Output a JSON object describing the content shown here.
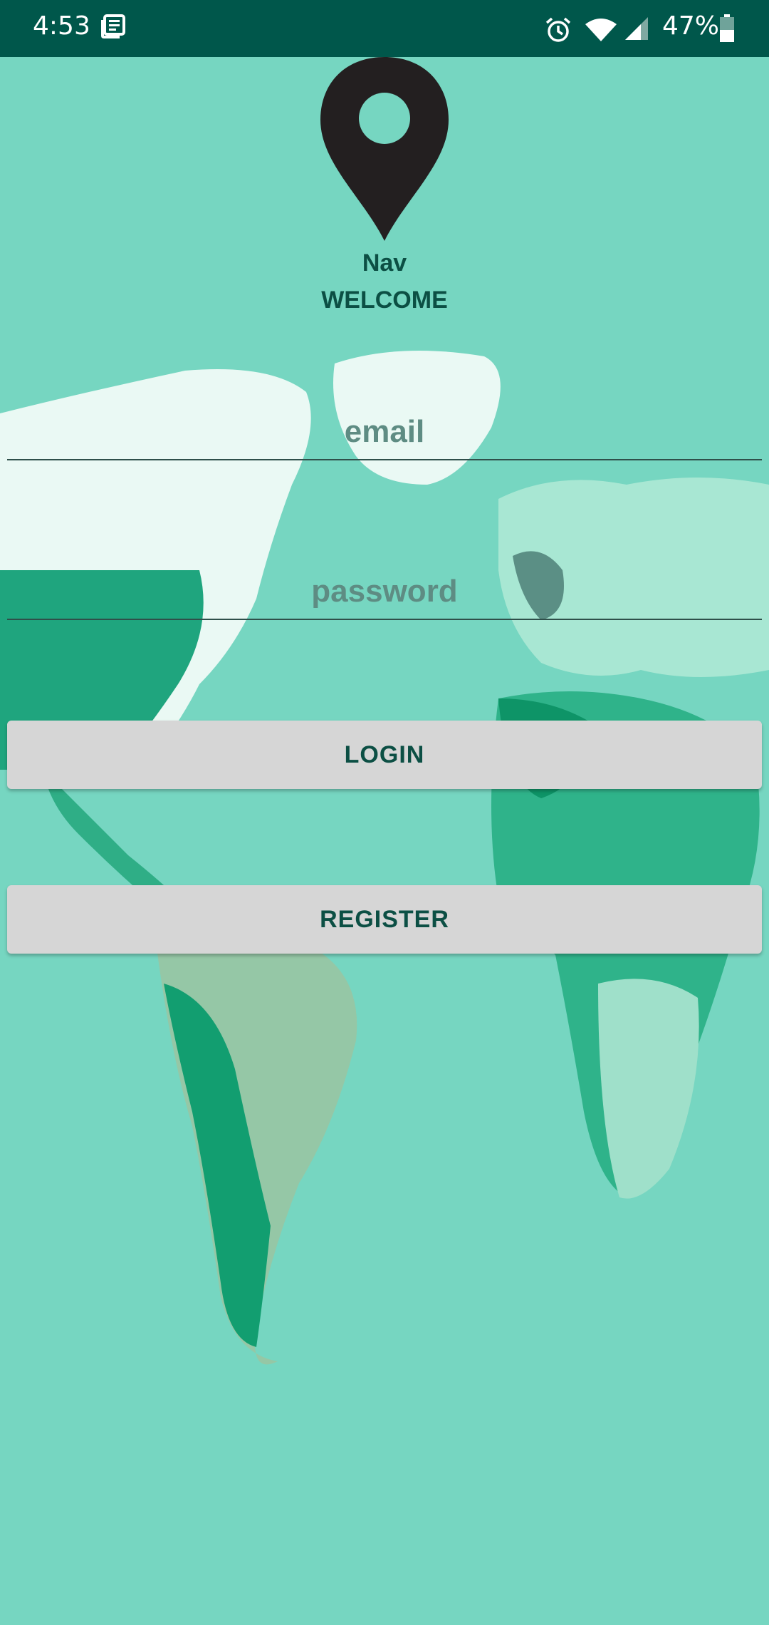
{
  "status_bar": {
    "time": "4:53",
    "battery": "47%",
    "icons": [
      "news-icon",
      "alarm-icon",
      "wifi-icon",
      "cell-signal-icon",
      "battery-icon"
    ]
  },
  "app": {
    "name": "Nav",
    "welcome": "WELCOME",
    "logo_icon": "map-pin-icon"
  },
  "form": {
    "email_placeholder": "email",
    "email_value": "",
    "password_placeholder": "password",
    "password_value": ""
  },
  "buttons": {
    "login": "LOGIN",
    "register": "REGISTER"
  },
  "colors": {
    "status_bar": "#00574b",
    "background": "#76d6c1",
    "accent_text": "#0c4f44",
    "button_bg": "#d6d6d6",
    "pin": "#231f20"
  }
}
